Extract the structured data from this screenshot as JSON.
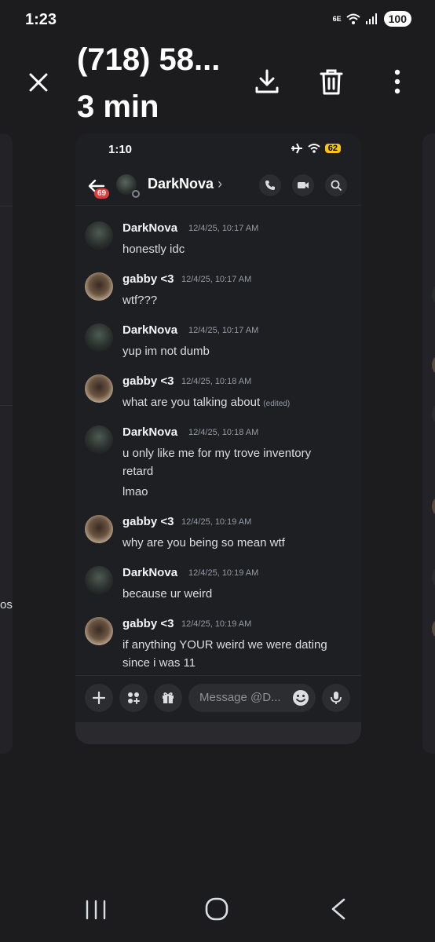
{
  "status_bar": {
    "time": "1:23",
    "network": "6E",
    "battery": "100"
  },
  "viewer": {
    "title": "(718) 58...",
    "subtitle": "3 min"
  },
  "side_left": {
    "label_fragment": "os"
  },
  "screenshot": {
    "status_bar": {
      "time": "1:10",
      "battery": "62"
    },
    "header": {
      "badge_count": "69",
      "name": "DarkNova",
      "chevron": "›"
    },
    "messages": [
      {
        "author": "DarkNova",
        "timestamp": "12/4/25, 10:17 AM",
        "lines": [
          "honestly idc"
        ]
      },
      {
        "author": "gabby <3",
        "timestamp": "12/4/25, 10:17 AM",
        "lines": [
          "wtf???"
        ]
      },
      {
        "author": "DarkNova",
        "timestamp": "12/4/25, 10:17 AM",
        "lines": [
          "yup im not dumb"
        ]
      },
      {
        "author": "gabby <3",
        "timestamp": "12/4/25, 10:18 AM",
        "lines": [
          "what are you talking about"
        ],
        "edited": "(edited)"
      },
      {
        "author": "DarkNova",
        "timestamp": "12/4/25, 10:18 AM",
        "lines": [
          "u only like me for my trove inventory",
          "retard",
          "lmao"
        ]
      },
      {
        "author": "gabby <3",
        "timestamp": "12/4/25, 10:19 AM",
        "lines": [
          "why are you being so mean wtf"
        ]
      },
      {
        "author": "DarkNova",
        "timestamp": "12/4/25, 10:19 AM",
        "lines": [
          "because ur weird"
        ]
      },
      {
        "author": "gabby <3",
        "timestamp": "12/4/25, 10:19 AM",
        "lines": [
          "if anything YOUR weird we were dating",
          "since i was 11"
        ]
      }
    ],
    "composer": {
      "placeholder": "Message @D..."
    }
  }
}
